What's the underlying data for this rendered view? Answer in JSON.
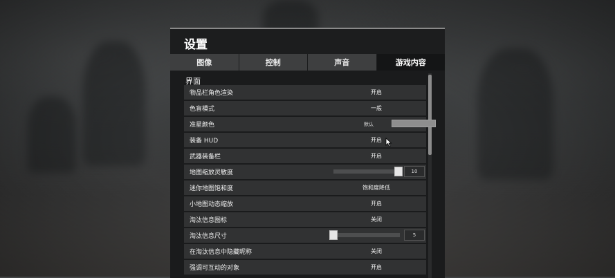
{
  "panel": {
    "title": "设置",
    "tabs": [
      {
        "label": "图像",
        "active": false
      },
      {
        "label": "控制",
        "active": false
      },
      {
        "label": "声音",
        "active": false
      },
      {
        "label": "游戏内容",
        "active": true
      }
    ]
  },
  "section": {
    "title": "界面"
  },
  "rows": [
    {
      "label": "物品栏角色渲染",
      "value": "开启"
    },
    {
      "label": "色盲模式",
      "value": "一般"
    },
    {
      "label": "准星颜色",
      "value": "默认",
      "swatch_color": "#8e8e8e"
    },
    {
      "label": "装备 HUD",
      "value": "开启"
    },
    {
      "label": "武器装备栏",
      "value": "开启"
    },
    {
      "label": "地图缩放灵敏度",
      "value": "10",
      "slider_fraction": 1.0
    },
    {
      "label": "迷你地图饱和度",
      "value": "饱和度降低"
    },
    {
      "label": "小地图动态缩放",
      "value": "开启"
    },
    {
      "label": "淘汰信息图标",
      "value": "关闭"
    },
    {
      "label": "淘汰信息尺寸",
      "value": "5",
      "slider_fraction": 0.0
    },
    {
      "label": "在淘汰信息中隐藏昵称",
      "value": "关闭"
    },
    {
      "label": "强调可互动的对象",
      "value": "开启"
    }
  ],
  "colors": {
    "panel_bg": "#1c1d1e",
    "row_bg": "#313233",
    "tab_bg": "#3e3f40",
    "tab_active_bg": "#141516"
  }
}
